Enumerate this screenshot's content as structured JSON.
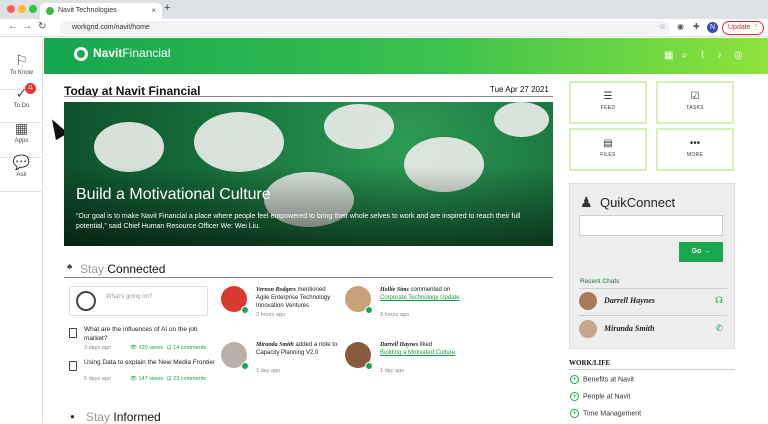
{
  "browser": {
    "tab_title": "Navit Technologies",
    "tab_close": "×",
    "new_tab": "+",
    "url": "workgrid.com/navit/home",
    "profile_initial": "N",
    "update_label": "Update"
  },
  "leftnav": {
    "items": [
      {
        "label": "To Know",
        "icon": "flag-icon",
        "glyph": "⚐"
      },
      {
        "label": "To Do",
        "icon": "checklist-icon",
        "glyph": "✓",
        "badge": "11"
      },
      {
        "label": "Apps",
        "icon": "apps-grid-icon",
        "glyph": "▦"
      },
      {
        "label": "Ask",
        "icon": "chat-bubble-icon",
        "glyph": "💬"
      }
    ]
  },
  "header": {
    "brand_bold": "Navit",
    "brand_rest": "Financial",
    "icons": [
      "grid-icon",
      "search-icon",
      "analytics-icon",
      "bell-icon",
      "account-icon"
    ],
    "accent": "#1aa84f"
  },
  "today": {
    "title": "Today at Navit Financial",
    "date": "Tue Apr 27 2021"
  },
  "hero": {
    "title": "Build a Motivational Culture",
    "quote": "“Our goal is to make Navit Financial a place where people feel empowered to bring their whole selves to work and are inspired to reach their full potential,” said Chief Human Resource Officer We: Wei Liu."
  },
  "stay_connected": {
    "title_light": "Stay",
    "title_bold": "Connected",
    "post_placeholder": "What's going on?",
    "questions": [
      {
        "text": "What are the influences of AI on the job market?",
        "time": "3 days ago",
        "views": "220 views",
        "comments": "14 comments"
      },
      {
        "text": "Using Data to explain the New Media Frontier",
        "time": "5 days ago",
        "views": "147 views",
        "comments": "23 comments"
      }
    ],
    "activity": [
      {
        "name": "Vernon Rodgers",
        "action": "mentioned",
        "target": "Agile Enterprise Technology Innovation Ventures",
        "time": "2 hours ago"
      },
      {
        "name": "Hollie Sims",
        "action": "commented on",
        "target": "Corporate Technology Update",
        "time": "8 hours ago"
      },
      {
        "name": "Miranda Smith",
        "action": "added a note to Capacity Planning V2.0",
        "target": "",
        "time": "1 day ago"
      },
      {
        "name": "Darrell Haynes",
        "action": "liked",
        "target": "Building a Motivated Culture",
        "time": "1 day ago"
      }
    ]
  },
  "stay_informed": {
    "title_light": "Stay",
    "title_bold": "Informed"
  },
  "tiles": [
    {
      "label": "FEED",
      "icon": "feed-icon",
      "glyph": "☰"
    },
    {
      "label": "TASKS",
      "icon": "tasks-icon",
      "glyph": "☑"
    },
    {
      "label": "FILES",
      "icon": "files-icon",
      "glyph": "▤"
    },
    {
      "label": "MORE",
      "icon": "more-icon",
      "glyph": "•••"
    }
  ],
  "quikconnect": {
    "title": "QuikConnect",
    "go_label": "Go →",
    "recent_label": "Recent Chats",
    "chats": [
      {
        "name": "Darrell Haynes",
        "icon": "headset-icon"
      },
      {
        "name": "Miranda Smith",
        "icon": "phone-off-icon"
      }
    ]
  },
  "worklife": {
    "title": "WORK/LIFE",
    "items": [
      "Benefits at Navit",
      "People at Navit",
      "Time Management"
    ]
  }
}
